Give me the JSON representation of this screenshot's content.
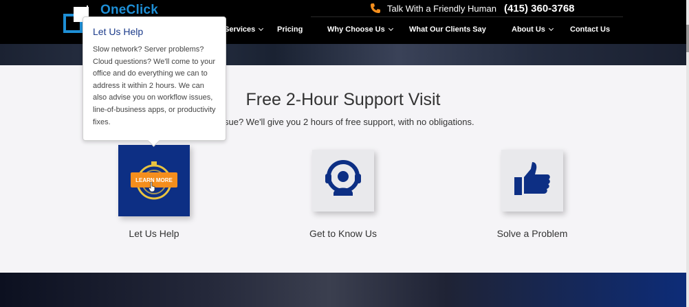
{
  "header": {
    "logo_text": "OneClick",
    "phone_label": "Talk With a Friendly Human",
    "phone_number": "(415) 360-3768",
    "nav": [
      {
        "label": "Services",
        "has_dropdown": true
      },
      {
        "label": "Pricing",
        "has_dropdown": false
      },
      {
        "label": "Why Choose Us",
        "has_dropdown": true
      },
      {
        "label": "What Our Clients Say",
        "has_dropdown": false
      },
      {
        "label": "About Us",
        "has_dropdown": true
      },
      {
        "label": "Contact Us",
        "has_dropdown": false
      }
    ]
  },
  "main": {
    "title": "Free 2-Hour Support Visit",
    "subtitle": "sue? We'll give you 2 hours of free support, with no obligations.",
    "cards": [
      {
        "label": "Let Us Help",
        "icon": "stopwatch-icon",
        "overlay_button": "LEARN MORE"
      },
      {
        "label": "Get to Know Us",
        "icon": "support-agent-icon"
      },
      {
        "label": "Solve a Problem",
        "icon": "thumbs-up-icon"
      }
    ]
  },
  "tooltip": {
    "title": "Let Us Help",
    "body": "Slow network? Server problems? Cloud questions? We'll come to your office and do everything we can to address it within 2 hours. We can also advise you on workflow issues, line-of-business apps, or productivity fixes."
  },
  "colors": {
    "brand_blue": "#0d2f84",
    "accent_orange": "#f48e1d",
    "logo_blue": "#1e8fd6"
  }
}
